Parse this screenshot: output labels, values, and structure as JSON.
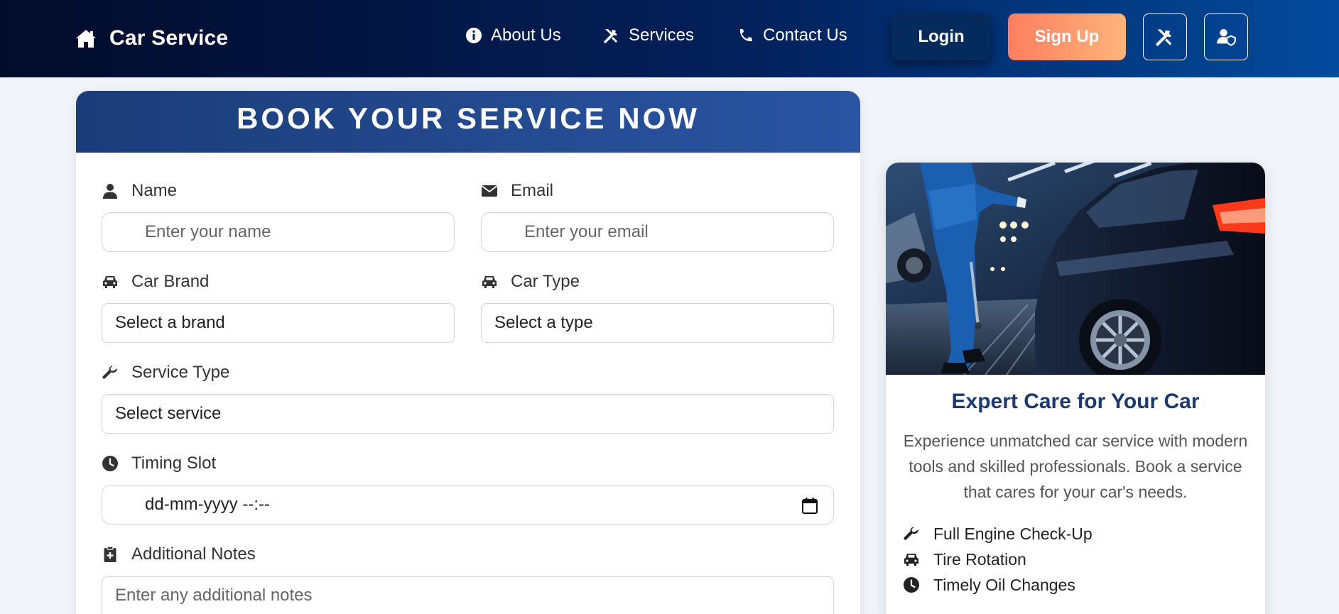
{
  "nav": {
    "brand": "Car Service",
    "links": {
      "about": "About Us",
      "services": "Services",
      "contact": "Contact Us"
    },
    "login": "Login",
    "signup": "Sign Up"
  },
  "form": {
    "title": "BOOK YOUR SERVICE NOW",
    "name": {
      "label": "Name",
      "placeholder": "Enter your name"
    },
    "email": {
      "label": "Email",
      "placeholder": "Enter your email"
    },
    "car_brand": {
      "label": "Car Brand",
      "value": "Select a brand"
    },
    "car_type": {
      "label": "Car Type",
      "value": "Select a type"
    },
    "service_type": {
      "label": "Service Type",
      "value": "Select service"
    },
    "timing": {
      "label": "Timing Slot",
      "value": "dd-mm-yyyy --:--"
    },
    "notes": {
      "label": "Additional Notes",
      "placeholder": "Enter any additional notes"
    }
  },
  "side": {
    "image_alt": "mechanic-with-car",
    "title": "Expert Care for Your Car",
    "description": "Experience unmatched car service with modern tools and skilled professionals. Book a service that cares for your car's needs.",
    "features": [
      "Full Engine Check-Up",
      "Tire Rotation",
      "Timely Oil Changes"
    ]
  },
  "colors": {
    "nav_dark": "#020b2a",
    "nav_light": "#034a9c",
    "form_header": "#1b3c78",
    "signup_start": "#ff7e5f",
    "signup_end": "#feb47b",
    "side_title": "#1c3a70"
  }
}
